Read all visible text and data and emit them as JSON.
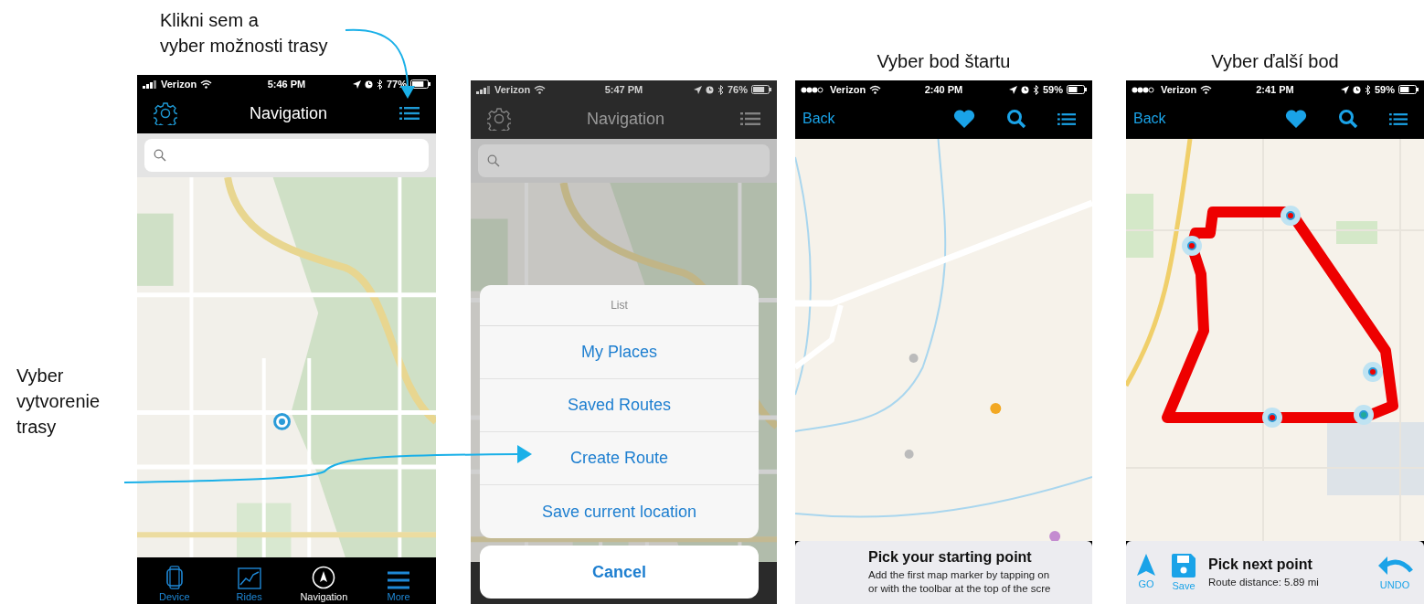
{
  "annotations": [
    {
      "text": "Klikni sem a\nvyber možnosti trasy"
    },
    {
      "text": "Vyber\nvytvorenie\ntrasy"
    }
  ],
  "screens": [
    {
      "kind": "home",
      "status": {
        "signal": {
          "kind": "bars"
        },
        "carrier": "Verizon",
        "time": "5:46 PM",
        "battery": "77%"
      },
      "title": "Navigation",
      "tabs": [
        {
          "kind": "device",
          "label": "Device",
          "selected": false
        },
        {
          "kind": "rides",
          "label": "Rides",
          "selected": false
        },
        {
          "kind": "navigation",
          "label": "Navigation",
          "selected": true
        },
        {
          "kind": "more",
          "label": "More",
          "selected": false
        }
      ]
    },
    {
      "kind": "sheet",
      "status": {
        "signal": {
          "kind": "bars"
        },
        "carrier": "Verizon",
        "time": "5:47 PM",
        "battery": "76%"
      },
      "title": "Navigation",
      "sheet": {
        "title": "List",
        "options": [
          "My Places",
          "Saved Routes",
          "Create Route",
          "Save current location"
        ],
        "cancel": "Cancel"
      }
    },
    {
      "kind": "route",
      "caption": "Vyber bod štartu",
      "status": {
        "signal": {
          "kind": "dots"
        },
        "carrier": "Verizon",
        "time": "2:40 PM",
        "battery": "59%"
      },
      "back": "Back",
      "map": {
        "kind": "start"
      },
      "panel": {
        "title": "Pick your starting point",
        "text": "Add the first map marker by tapping on\nor with the toolbar at the top of the scre"
      }
    },
    {
      "kind": "route",
      "caption": "Vyber ďalší bod",
      "status": {
        "signal": {
          "kind": "dots"
        },
        "carrier": "Verizon",
        "time": "2:41 PM",
        "battery": "59%"
      },
      "back": "Back",
      "map": {
        "kind": "route"
      },
      "panel": {
        "title": "Pick next point",
        "text": "Route distance: 5.89 mi",
        "actions": [
          {
            "kind": "go",
            "label": "GO"
          },
          {
            "kind": "save",
            "label": "Save"
          },
          {
            "kind": "undo",
            "label": "UNDO"
          }
        ]
      }
    }
  ]
}
